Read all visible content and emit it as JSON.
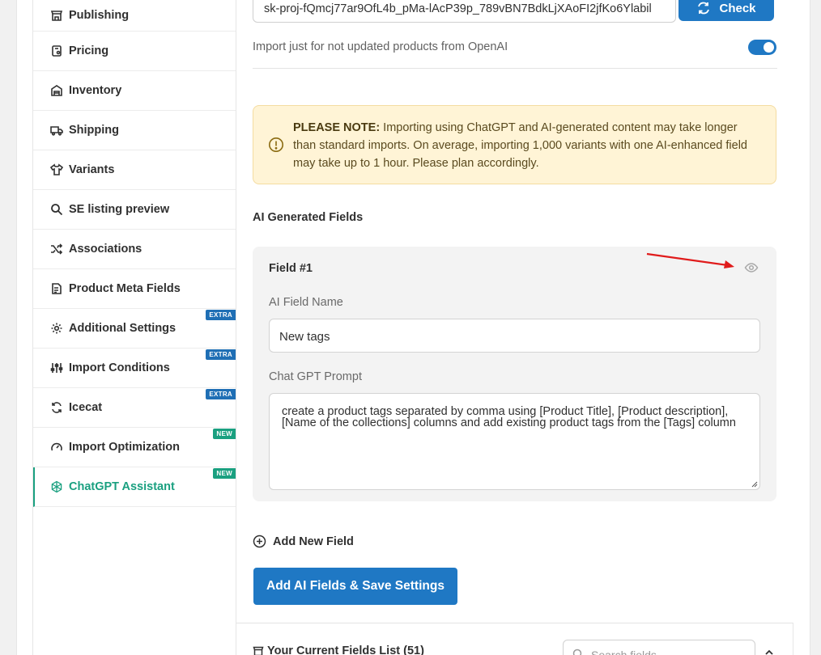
{
  "sidebar": {
    "items": [
      {
        "label": "Publishing",
        "icon": "store-icon",
        "badge": null
      },
      {
        "label": "Pricing",
        "icon": "price-tag-icon",
        "badge": null
      },
      {
        "label": "Inventory",
        "icon": "warehouse-icon",
        "badge": null
      },
      {
        "label": "Shipping",
        "icon": "truck-icon",
        "badge": null
      },
      {
        "label": "Variants",
        "icon": "shirt-icon",
        "badge": null
      },
      {
        "label": "SE listing preview",
        "icon": "search-icon",
        "badge": null
      },
      {
        "label": "Associations",
        "icon": "shuffle-icon",
        "badge": null
      },
      {
        "label": "Product Meta Fields",
        "icon": "document-icon",
        "badge": null
      },
      {
        "label": "Additional Settings",
        "icon": "gear-icon",
        "badge": "EXTRA"
      },
      {
        "label": "Import Conditions",
        "icon": "sliders-icon",
        "badge": "EXTRA"
      },
      {
        "label": "Icecat",
        "icon": "refresh-icon",
        "badge": "EXTRA"
      },
      {
        "label": "Import Optimization",
        "icon": "gauge-icon",
        "badge": "NEW"
      },
      {
        "label": "ChatGPT Assistant",
        "icon": "openai-icon",
        "badge": "NEW",
        "active": true
      }
    ]
  },
  "api_key": {
    "value": "sk-proj-fQmcj77ar9OfL4b_pMa-lAcP39p_789vBN7BdkLjXAoFI2jfKo6Ylabil",
    "check_label": "Check"
  },
  "toggle": {
    "label": "Import just for not updated products from OpenAI",
    "enabled": true
  },
  "note": {
    "strong": "PLEASE NOTE:",
    "text": " Importing using ChatGPT and AI-generated content may take longer than standard imports. On average, importing 1,000 variants with one AI-enhanced field may take up to 1 hour. Please plan accordingly."
  },
  "ai_section": {
    "title": "AI Generated Fields",
    "field": {
      "title": "Field #1",
      "name_label": "AI Field Name",
      "name_value": "New tags",
      "prompt_label": "Chat GPT Prompt",
      "prompt_value": "create a product tags separated by comma using [Product Title], [Product description], [Name of the collections] columns and add existing product tags from the [Tags] column"
    },
    "add_label": "Add New Field",
    "save_label": "Add AI Fields & Save Settings"
  },
  "fields_list": {
    "label": "Your Current Fields List (51)",
    "search_placeholder": "Search fields"
  },
  "colors": {
    "accent_blue": "#1f78c4",
    "accent_green": "#1aa080",
    "note_bg": "#fff4d6",
    "arrow_red": "#e01b1b"
  }
}
